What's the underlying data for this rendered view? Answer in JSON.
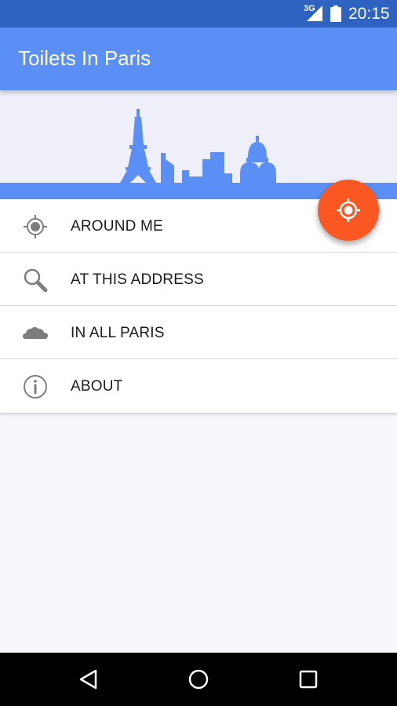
{
  "status_bar": {
    "network": "3G",
    "time": "20:15"
  },
  "app_bar": {
    "title": "Toilets In Paris"
  },
  "colors": {
    "primary": "#5b8ff5",
    "status_bar": "#2e63c2",
    "accent": "#fb5722",
    "menu_icon": "#7d7d7d"
  },
  "menu": {
    "items": [
      {
        "label": "AROUND ME",
        "icon": "location-target-icon"
      },
      {
        "label": "AT THIS ADDRESS",
        "icon": "search-icon"
      },
      {
        "label": "IN ALL PARIS",
        "icon": "cloud-icon"
      },
      {
        "label": "ABOUT",
        "icon": "info-icon"
      }
    ]
  },
  "fab": {
    "icon": "my-location-icon"
  },
  "nav_bar": {
    "buttons": [
      "back-icon",
      "home-icon",
      "recents-icon"
    ]
  }
}
